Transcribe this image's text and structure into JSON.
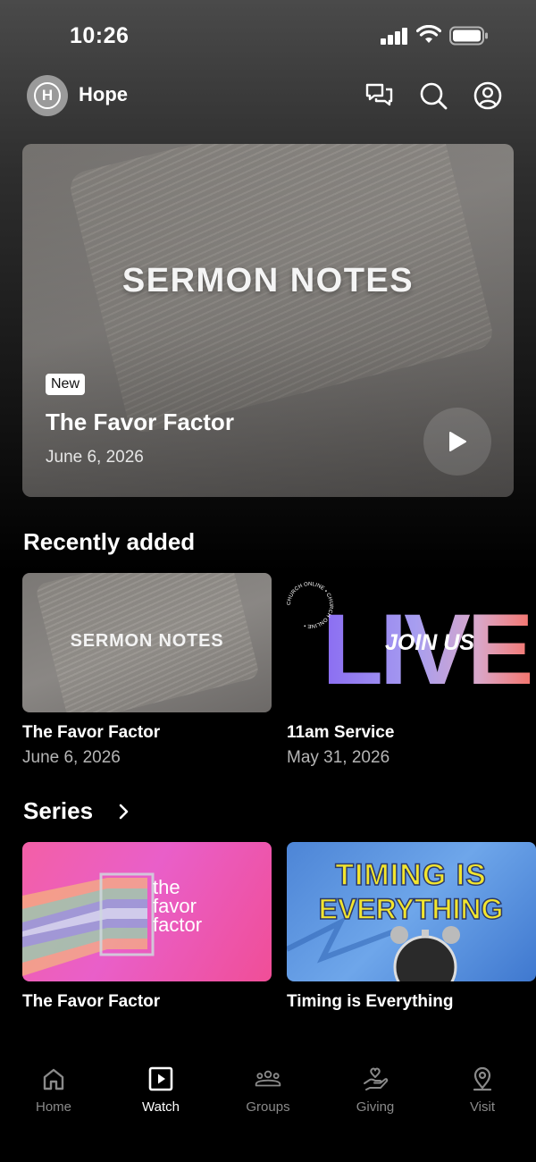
{
  "status_bar": {
    "time": "10:26"
  },
  "header": {
    "app_name": "Hope",
    "avatar_letter": "H"
  },
  "hero": {
    "art_text": "SERMON NOTES",
    "badge": "New",
    "title": "The Favor Factor",
    "date": "June 6, 2026"
  },
  "recently_added": {
    "title": "Recently added",
    "items": [
      {
        "art_text": "SERMON NOTES",
        "title": "The Favor Factor",
        "date": "June 6, 2026"
      },
      {
        "art_big": "LIVE",
        "art_overlay": "JOIN US",
        "art_ring": "CHURCH ONLINE • CHURCH ONLINE •",
        "title": "11am Service",
        "date": "May 31, 2026"
      }
    ]
  },
  "series": {
    "title": "Series",
    "items": [
      {
        "art_text": "the favor factor",
        "title": "The Favor Factor"
      },
      {
        "art_line1": "TIMING IS",
        "art_line2": "EVERYTHING",
        "title": "Timing is Everything"
      }
    ]
  },
  "bottom_nav": {
    "items": [
      {
        "label": "Home",
        "icon": "home-icon",
        "active": false
      },
      {
        "label": "Watch",
        "icon": "play-square-icon",
        "active": true
      },
      {
        "label": "Groups",
        "icon": "groups-icon",
        "active": false
      },
      {
        "label": "Giving",
        "icon": "giving-hand-icon",
        "active": false
      },
      {
        "label": "Visit",
        "icon": "location-pin-icon",
        "active": false
      }
    ]
  },
  "colors": {
    "background": "#000000",
    "nav_inactive": "#8a8a8a",
    "nav_active": "#ffffff",
    "secondary_text": "#b5b5b5"
  }
}
